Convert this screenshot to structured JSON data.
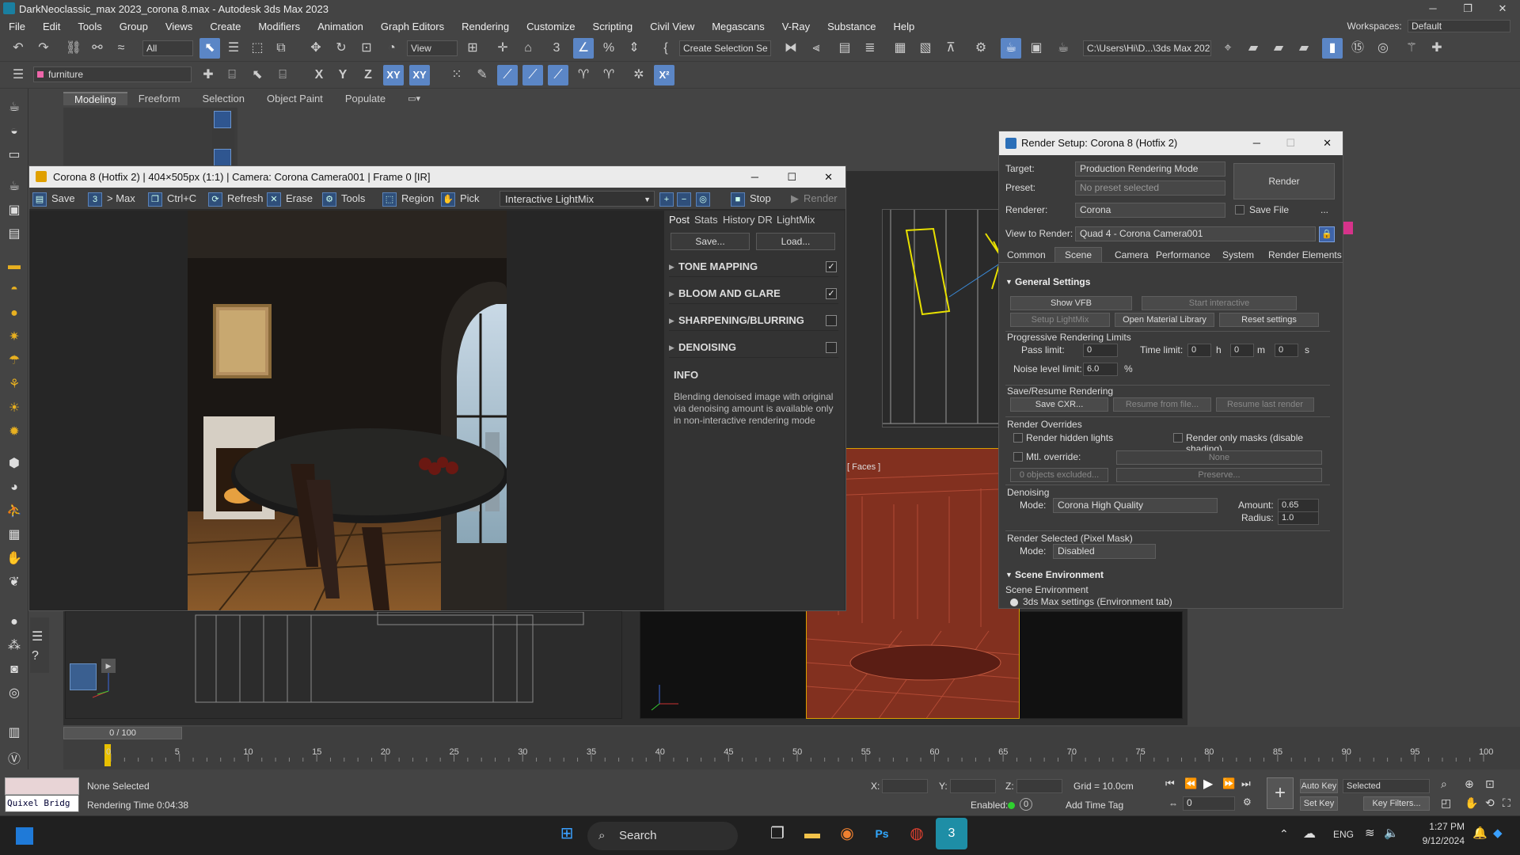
{
  "app": {
    "window_title": "DarkNeoclassic_max 2023_corona 8.max - Autodesk 3ds Max 2023",
    "workspaces_label": "Workspaces:",
    "workspace_value": "Default"
  },
  "menu": [
    "File",
    "Edit",
    "Tools",
    "Group",
    "Views",
    "Create",
    "Modifiers",
    "Animation",
    "Graph Editors",
    "Rendering",
    "Customize",
    "Scripting",
    "Civil View",
    "Megascans",
    "V-Ray",
    "Substance",
    "Help"
  ],
  "toolbar": {
    "filter_select": "All",
    "view_select": "View",
    "selection_set": "Create Selection Se",
    "path": "C:\\Users\\Hi\\D...\\3ds Max 2023",
    "layer_select": "furniture",
    "axis_x": "X",
    "axis_y": "Y",
    "axis_z": "Z",
    "axis_xy": "XY",
    "axis_xy2": "XY"
  },
  "ribbon_tabs": [
    "Modeling",
    "Freeform",
    "Selection",
    "Object Paint",
    "Populate"
  ],
  "vfb": {
    "title": "Corona 8 (Hotfix 2) | 404×505px (1:1) | Camera: Corona Camera001 | Frame 0 [IR]",
    "save": "Save",
    "to_max": "> Max",
    "copy": "Ctrl+C",
    "refresh": "Refresh",
    "erase": "Erase",
    "tools": "Tools",
    "region": "Region",
    "pick": "Pick",
    "lightmix": "Interactive LightMix",
    "stop": "Stop",
    "render": "Render",
    "tabs": [
      "Post",
      "Stats",
      "History",
      "DR",
      "LightMix"
    ],
    "save_btn": "Save...",
    "load_btn": "Load...",
    "sections": [
      {
        "label": "TONE MAPPING",
        "checked": true
      },
      {
        "label": "BLOOM AND GLARE",
        "checked": true
      },
      {
        "label": "SHARPENING/BLURRING",
        "checked": false
      },
      {
        "label": "DENOISING",
        "checked": false
      }
    ],
    "info_title": "INFO",
    "info_text": "Blending denoised image with original via denoising amount is available only in non-interactive rendering mode"
  },
  "render_setup": {
    "title": "Render Setup: Corona 8 (Hotfix 2)",
    "target_label": "Target:",
    "target_value": "Production Rendering Mode",
    "preset_label": "Preset:",
    "preset_value": "No preset selected",
    "renderer_label": "Renderer:",
    "renderer_value": "Corona",
    "save_file": "Save File",
    "render_btn": "Render",
    "view_label": "View to Render:",
    "view_value": "Quad 4 - Corona Camera001",
    "tabs": [
      "Common",
      "Scene",
      "Camera",
      "Performance",
      "System",
      "Render Elements"
    ],
    "general_settings": "General Settings",
    "show_vfb": "Show VFB",
    "start_interactive": "Start interactive",
    "setup_lightmix": "Setup LightMix",
    "open_material_library": "Open Material Library",
    "reset_settings": "Reset settings",
    "prog_limits": "Progressive Rendering Limits",
    "pass_limit_label": "Pass limit:",
    "pass_limit": "0",
    "time_limit_label": "Time limit:",
    "time_h": "0",
    "time_m": "0",
    "time_s": "0",
    "unit_h": "h",
    "unit_m": "m",
    "unit_s": "s",
    "noise_label": "Noise level limit:",
    "noise_value": "6.0",
    "percent": "%",
    "save_resume": "Save/Resume Rendering",
    "save_cxr": "Save CXR...",
    "resume_file": "Resume from file...",
    "resume_last": "Resume last render",
    "overrides": "Render Overrides",
    "hidden_lights": "Render hidden lights",
    "only_masks": "Render only masks (disable shading)",
    "mtl_override": "Mtl. override:",
    "mtl_none": "None",
    "objects_excluded": "0 objects excluded...",
    "preserve": "Preserve...",
    "denoising": "Denoising",
    "mode_label": "Mode:",
    "denoise_mode": "Corona High Quality",
    "amount_label": "Amount:",
    "amount_value": "0.65",
    "radius_label": "Radius:",
    "radius_value": "1.0",
    "render_selected": "Render Selected (Pixel Mask)",
    "mode2_label": "Mode:",
    "render_selected_mode": "Disabled",
    "scene_env": "Scene Environment",
    "scene_env_sub": "Scene Environment",
    "env_option": "3ds Max settings (Environment tab)"
  },
  "viewport_label": "[ Faces ]",
  "timeline": {
    "frame": "0 / 100",
    "ticks": [
      "0",
      "5",
      "10",
      "15",
      "20",
      "25",
      "30",
      "35",
      "40",
      "45",
      "50",
      "55",
      "60",
      "65",
      "70",
      "75",
      "80",
      "85",
      "90",
      "95",
      "100"
    ]
  },
  "status": {
    "quixel": "Quixel Bridg",
    "selection": "None Selected",
    "render_time": "Rendering Time  0:04:38",
    "x_label": "X:",
    "y_label": "Y:",
    "z_label": "Z:",
    "grid": "Grid = 10.0cm",
    "enabled": "Enabled:",
    "enabled_value": "0",
    "add_time_tag": "Add Time Tag",
    "auto_key": "Auto Key",
    "set_key": "Set Key",
    "selected": "Selected",
    "key_filters": "Key Filters...",
    "frame_value": "0"
  },
  "taskbar": {
    "search": "Search",
    "lang": "ENG",
    "time": "1:27 PM",
    "date": "9/12/2024"
  },
  "colors": {
    "accent": "#5b86c6",
    "title_light": "#ebebeb",
    "wireframe_yellow": "#e8e000",
    "viewport_red": "#8a2e22"
  }
}
